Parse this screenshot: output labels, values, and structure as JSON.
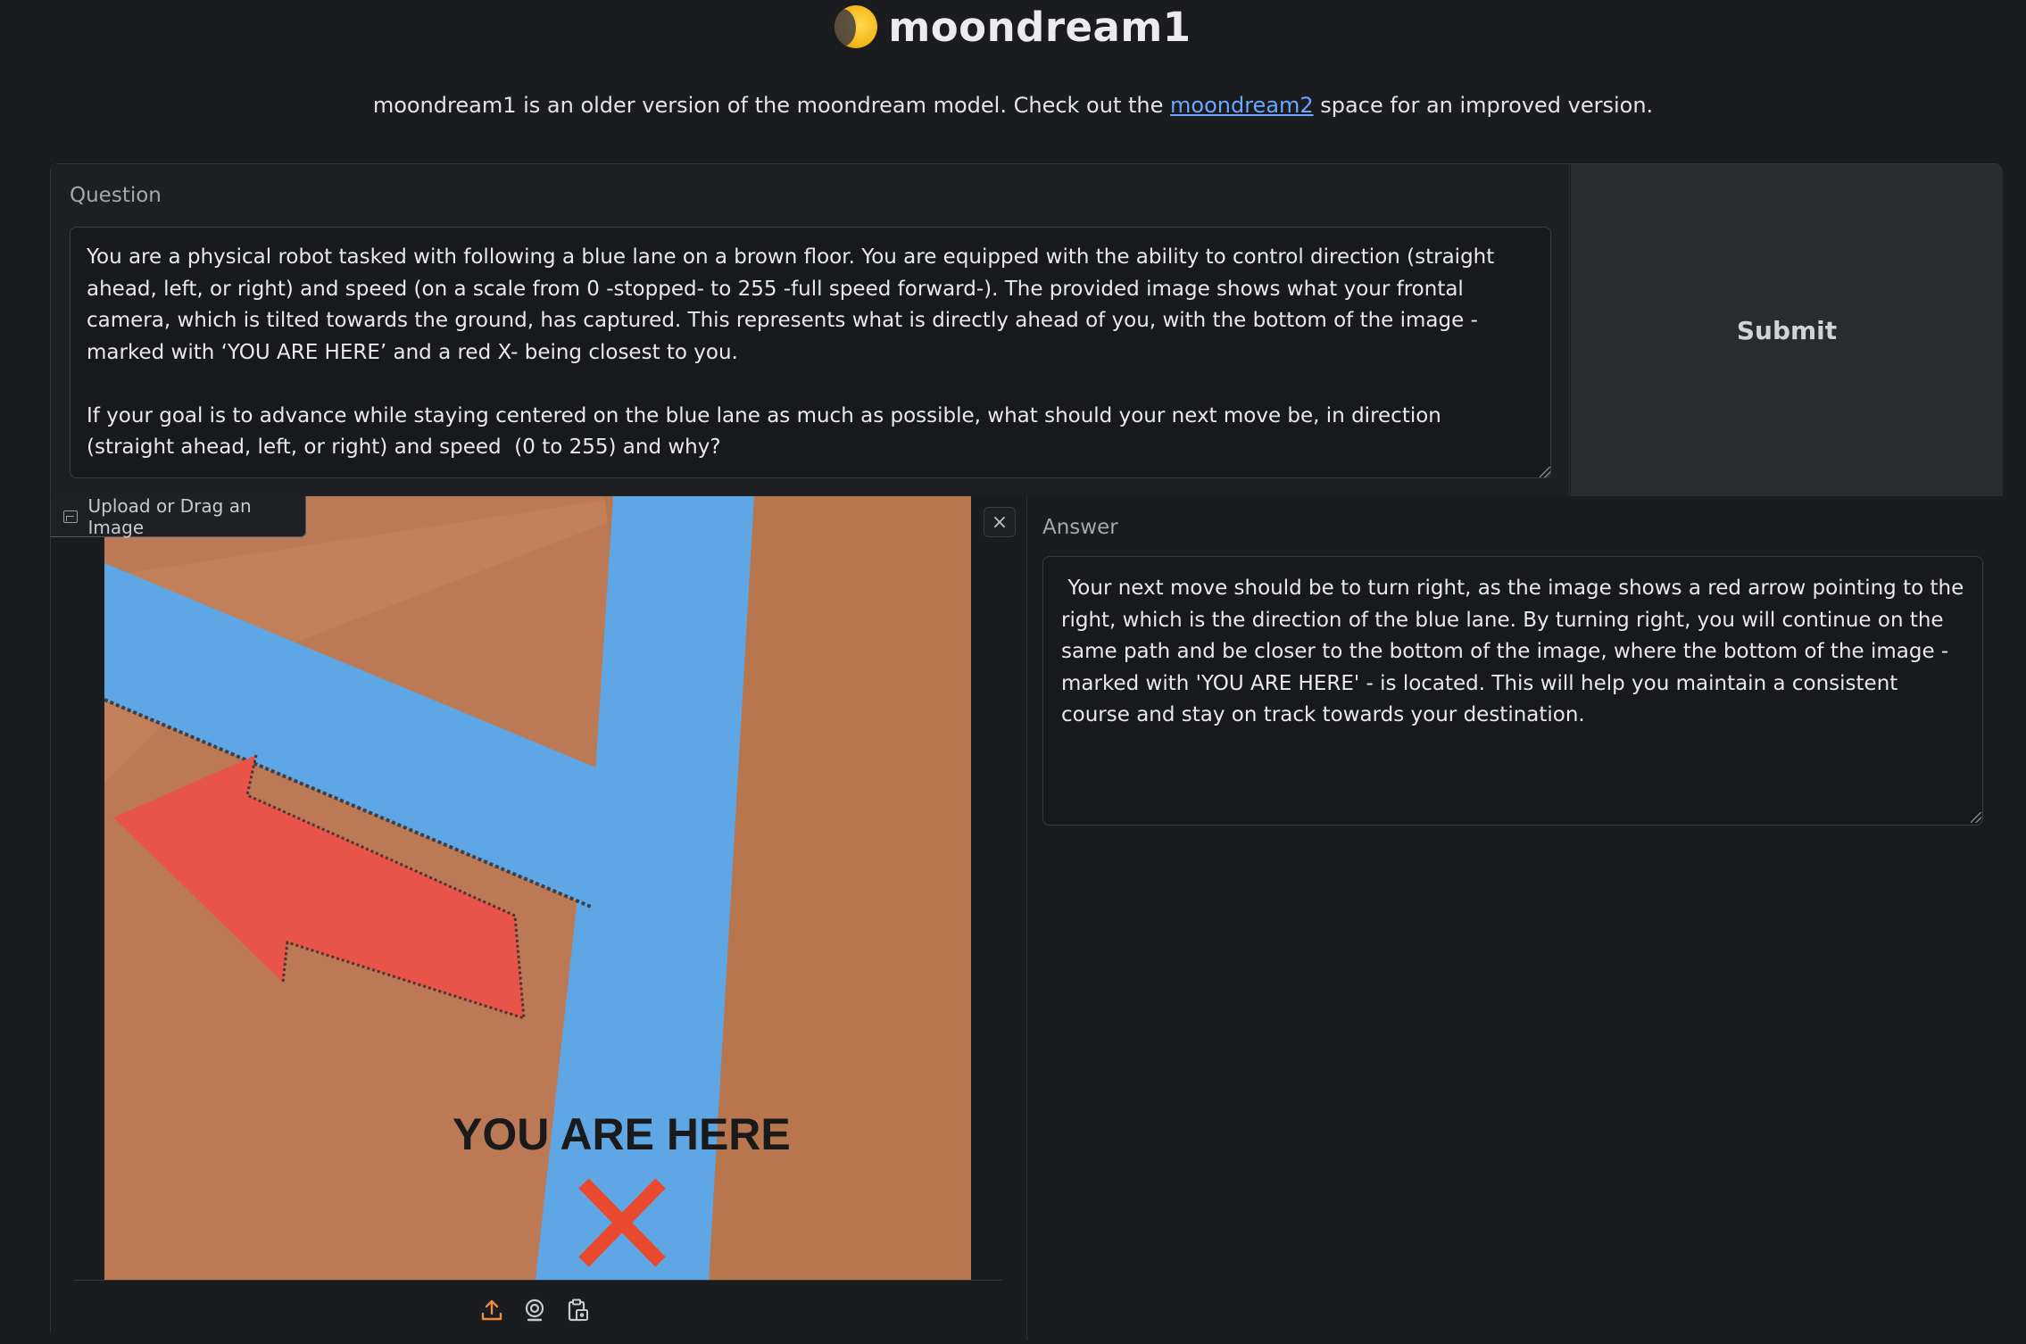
{
  "header": {
    "title": "moondream1",
    "subtitle_before": "moondream1 is an older version of the moondream model. Check out the ",
    "subtitle_link": "moondream2",
    "subtitle_after": " space for an improved version."
  },
  "question": {
    "label": "Question",
    "value": "You are a physical robot tasked with following a blue lane on a brown floor. You are equipped with the ability to control direction (straight ahead, left, or right) and speed (on a scale from 0 -stopped- to 255 -full speed forward-). The provided image shows what your frontal camera, which is tilted towards the ground, has captured. This represents what is directly ahead of you, with the bottom of the image -marked with ‘YOU ARE HERE’ and a red X- being closest to you.\n\nIf your goal is to advance while staying centered on the blue lane as much as possible, what should your next move be, in direction (straight ahead, left, or right) and speed  (0 to 255) and why?"
  },
  "submit": {
    "label": "Submit"
  },
  "image_input": {
    "tab_label": "Upload or Drag an Image",
    "close_symbol": "×",
    "photo_text": "YOU ARE HERE",
    "source_icons": [
      "upload-icon",
      "webcam-icon",
      "clipboard-icon"
    ]
  },
  "answer": {
    "label": "Answer",
    "value": " Your next move should be to turn right, as the image shows a red arrow pointing to the right, which is the direction of the blue lane. By turning right, you will continue on the same path and be closer to the bottom of the image, where the bottom of the image -marked with 'YOU ARE HERE' - is located. This will help you maintain a consistent course and stay on track towards your destination."
  },
  "colors": {
    "background": "#1b1c1f",
    "accent_orange": "#f08a3c",
    "link": "#6aa8ff",
    "floor": "#bb7a55",
    "lane": "#5ea6e4",
    "arrow": "#e8534a"
  }
}
